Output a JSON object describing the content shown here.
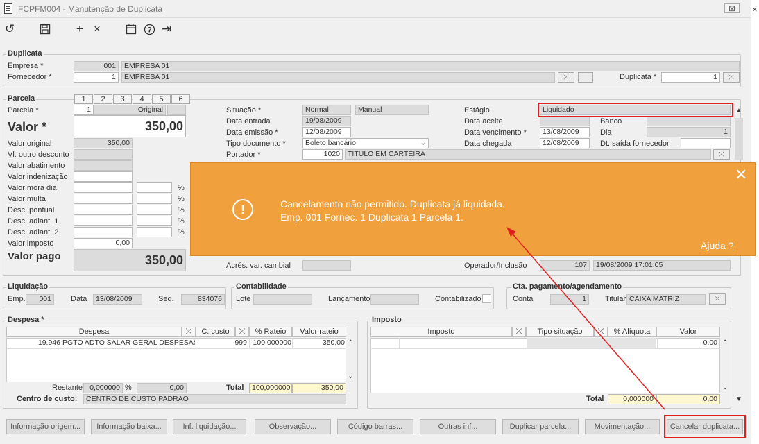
{
  "window": {
    "title": "FCPFM004 - Manutenção de Duplicata",
    "close": "⊠"
  },
  "icons": {
    "refresh": "refresh-icon",
    "save": "save-icon",
    "add": "add-icon",
    "cancel": "close-icon",
    "calendar": "calendar-icon",
    "help": "help-icon",
    "exit": "exit-icon"
  },
  "duplicata": {
    "group": "Duplicata",
    "empresa_label": "Empresa *",
    "empresa_code": "001",
    "empresa_name": "EMPRESA 01",
    "fornecedor_label": "Fornecedor *",
    "fornecedor_code": "1",
    "fornecedor_name": "EMPRESA 01",
    "duplicata_label": "Duplicata *",
    "duplicata_value": "1"
  },
  "parcela": {
    "group": "Parcela",
    "tabs": [
      "1",
      "2",
      "3",
      "4",
      "5",
      "6"
    ],
    "parcela_label": "Parcela *",
    "parcela_value": "1",
    "parcela_type": "Original",
    "valor_label": "Valor *",
    "valor_value": "350,00",
    "rows": [
      {
        "label": "Valor original",
        "value": "350,00"
      },
      {
        "label": "Vl. outro desconto",
        "value": ""
      },
      {
        "label": "Valor abatimento",
        "value": ""
      },
      {
        "label": "Valor indenização",
        "value": ""
      },
      {
        "label": "Valor mora dia",
        "value": ""
      },
      {
        "label": "Valor multa",
        "value": ""
      },
      {
        "label": "Desc. pontual",
        "value": ""
      },
      {
        "label": "Desc. adiant. 1",
        "value": ""
      },
      {
        "label": "Desc. adiant. 2",
        "value": ""
      },
      {
        "label": "Valor imposto",
        "value": "0,00"
      }
    ],
    "pct": "%",
    "valor_pago_label": "Valor pago",
    "valor_pago_value": "350,00",
    "situacao_label": "Situação *",
    "situacao_value": "Normal",
    "situacao_extra": "Manual",
    "data_entrada_label": "Data entrada",
    "data_entrada_value": "19/08/2009",
    "data_emissao_label": "Data emissão *",
    "data_emissao_value": "12/08/2009",
    "tipo_doc_label": "Tipo documento *",
    "tipo_doc_value": "Boleto bancário",
    "portador_label": "Portador *",
    "portador_code": "1020",
    "portador_name": "TITULO EM CARTEIRA",
    "estagio_label": "Estágio",
    "estagio_value": "Liquidado",
    "data_aceite_label": "Data aceite",
    "banco_label": "Banco",
    "data_venc_label": "Data vencimento *",
    "data_venc_value": "13/08/2009",
    "dia_label": "Dia",
    "dia_value": "1",
    "data_chegada_label": "Data chegada",
    "data_chegada_value": "12/08/2009",
    "dt_saida_label": "Dt. saída fornecedor",
    "acres_label": "Acrés. var. cambial",
    "operador_label": "Operador/Inclusão",
    "operador_value": "107",
    "operador_datetime": "19/08/2009 17:01:05"
  },
  "liquidacao": {
    "group": "Liquidação",
    "emp_label": "Emp.",
    "emp_value": "001",
    "data_label": "Data",
    "data_value": "13/08/2009",
    "seq_label": "Seq.",
    "seq_value": "834076"
  },
  "contabilidade": {
    "group": "Contabilidade",
    "lote_label": "Lote",
    "lancamento_label": "Lançamento",
    "contabilizado_label": "Contabilizado"
  },
  "cta": {
    "group": "Cta. pagamento/agendamento",
    "conta_label": "Conta",
    "conta_value": "1",
    "titular_label": "Titular",
    "titular_value": "CAIXA MATRIZ"
  },
  "despesa": {
    "group": "Despesa *",
    "headers": [
      "Despesa",
      "C. custo",
      "% Rateio",
      "Valor rateio"
    ],
    "row": {
      "codigo": "19.946",
      "descricao": "PGTO ADTO SALAR GERAL DESPESAS",
      "ccusto": "999",
      "rateio": "100,000000",
      "valor": "350,00"
    },
    "restante_label": "Restante",
    "restante_pct": "0,000000",
    "restante_val": "0,00",
    "pct": "%",
    "total_label": "Total",
    "total_pct": "100,000000",
    "total_val": "350,00",
    "cc_label": "Centro de custo:",
    "cc_value": "CENTRO DE CUSTO PADRAO"
  },
  "imposto": {
    "group": "Imposto",
    "headers": [
      "Imposto",
      "Tipo situação",
      "% Alíquota",
      "Valor"
    ],
    "row_valor": "0,00",
    "total_label": "Total",
    "total_pct": "0,000000",
    "total_val": "0,00"
  },
  "buttons": [
    "Informação origem...",
    "Informação baixa...",
    "Inf. liquidação...",
    "Observação...",
    "Código barras...",
    "Outras inf...",
    "Duplicar parcela...",
    "Movimentação...",
    "Cancelar duplicata..."
  ],
  "toast": {
    "line1": "Cancelamento não permitido. Duplicata já liquidada.",
    "line2": "Emp. 001 Fornec. 1 Duplicata 1 Parcela 1.",
    "help": "Ajuda ?",
    "close": "✕",
    "icon": "!"
  },
  "colors": {
    "toast": "#f0a03c",
    "highlight": "#e02020",
    "yellow_total": "#fff7d0"
  }
}
